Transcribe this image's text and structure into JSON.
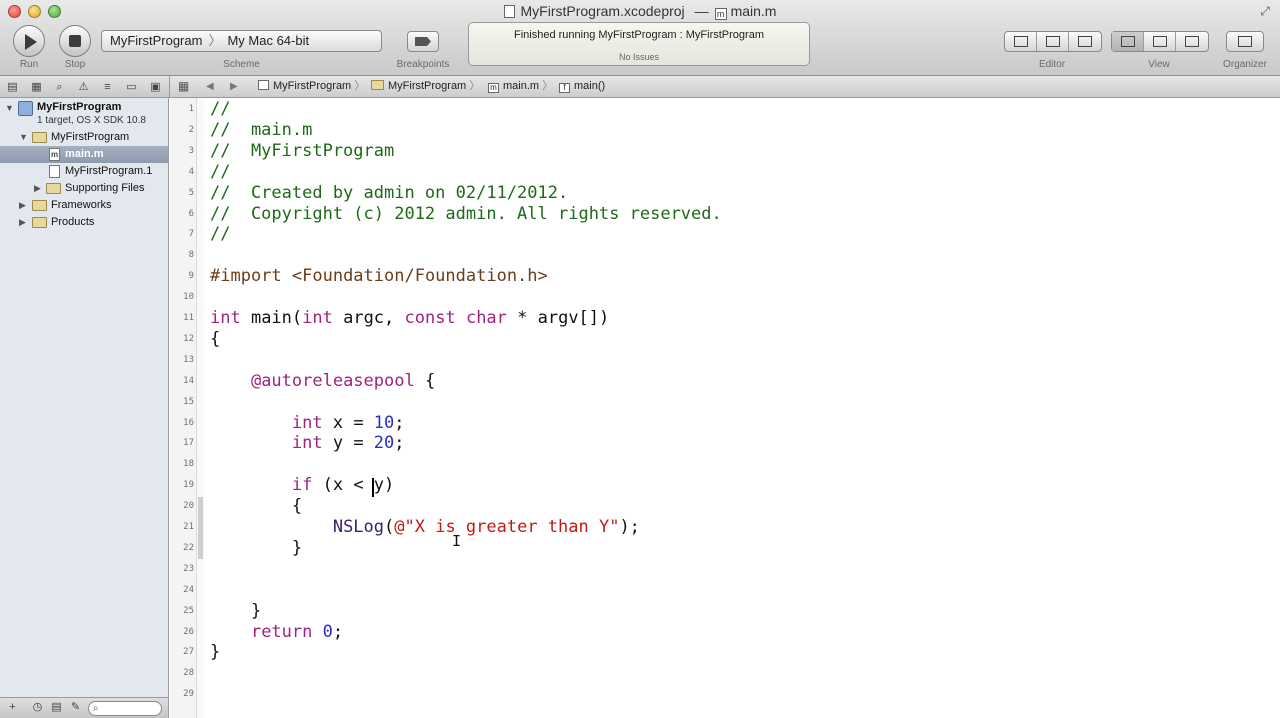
{
  "window": {
    "title_project_file": "MyFirstProgram.xcodeproj",
    "title_separator": "—",
    "title_file": "main.m"
  },
  "toolbar": {
    "run_label": "Run",
    "stop_label": "Stop",
    "scheme_target": "MyFirstProgram",
    "scheme_destination": "My Mac 64-bit",
    "scheme_label": "Scheme",
    "breakpoints_label": "Breakpoints",
    "activity_status": "Finished running MyFirstProgram : MyFirstProgram",
    "activity_issues": "No Issues",
    "editor_label": "Editor",
    "view_label": "View",
    "organizer_label": "Organizer"
  },
  "jump_bar": {
    "items": [
      "MyFirstProgram",
      "MyFirstProgram",
      "main.m",
      "main()"
    ],
    "file_icon_letter": "m",
    "func_icon_letter": "f"
  },
  "navigator": {
    "project_name": "MyFirstProgram",
    "project_subtitle": "1 target, OS X SDK 10.8",
    "items": [
      {
        "label": "MyFirstProgram",
        "type": "folder",
        "expanded": true
      },
      {
        "label": "main.m",
        "type": "file",
        "icon": "m",
        "selected": true
      },
      {
        "label": "MyFirstProgram.1",
        "type": "file",
        "icon": ""
      },
      {
        "label": "Supporting Files",
        "type": "folder",
        "expanded": false
      },
      {
        "label": "Frameworks",
        "type": "folder",
        "expanded": false
      },
      {
        "label": "Products",
        "type": "folder",
        "expanded": false
      }
    ]
  },
  "editor": {
    "language": "Objective-C",
    "caret_line": 19,
    "line_numbers": [
      "1",
      "2",
      "3",
      "4",
      "5",
      "6",
      "7",
      "8",
      "9",
      "10",
      "11",
      "12",
      "13",
      "14",
      "15",
      "16",
      "17",
      "18",
      "19",
      "20",
      "21",
      "22",
      "23",
      "24",
      "25",
      "26",
      "27",
      "28",
      "29"
    ],
    "lines": [
      [
        {
          "t": "//",
          "c": "comment"
        }
      ],
      [
        {
          "t": "//  main.m",
          "c": "comment"
        }
      ],
      [
        {
          "t": "//  MyFirstProgram",
          "c": "comment"
        }
      ],
      [
        {
          "t": "//",
          "c": "comment"
        }
      ],
      [
        {
          "t": "//  Created by admin on 02/11/2012.",
          "c": "comment"
        }
      ],
      [
        {
          "t": "//  Copyright (c) 2012 admin. All rights reserved.",
          "c": "comment"
        }
      ],
      [
        {
          "t": "//",
          "c": "comment"
        }
      ],
      [],
      [
        {
          "t": "#import ",
          "c": "pre"
        },
        {
          "t": "<Foundation/Foundation.h>",
          "c": "pre"
        }
      ],
      [],
      [
        {
          "t": "int",
          "c": "kw"
        },
        {
          "t": " main(",
          "c": ""
        },
        {
          "t": "int",
          "c": "kw"
        },
        {
          "t": " argc, ",
          "c": ""
        },
        {
          "t": "const",
          "c": "kw"
        },
        {
          "t": " ",
          "c": ""
        },
        {
          "t": "char",
          "c": "kw"
        },
        {
          "t": " * argv[])",
          "c": ""
        }
      ],
      [
        {
          "t": "{",
          "c": ""
        }
      ],
      [],
      [
        {
          "t": "    ",
          "c": ""
        },
        {
          "t": "@autoreleasepool",
          "c": "kw"
        },
        {
          "t": " {",
          "c": ""
        }
      ],
      [],
      [
        {
          "t": "        ",
          "c": ""
        },
        {
          "t": "int",
          "c": "kw"
        },
        {
          "t": " x = ",
          "c": ""
        },
        {
          "t": "10",
          "c": "num"
        },
        {
          "t": ";",
          "c": ""
        }
      ],
      [
        {
          "t": "        ",
          "c": ""
        },
        {
          "t": "int",
          "c": "kw"
        },
        {
          "t": " y = ",
          "c": ""
        },
        {
          "t": "20",
          "c": "num"
        },
        {
          "t": ";",
          "c": ""
        }
      ],
      [],
      [
        {
          "t": "        ",
          "c": ""
        },
        {
          "t": "if",
          "c": "kw"
        },
        {
          "t": " (x < y)",
          "c": ""
        }
      ],
      [
        {
          "t": "        {",
          "c": ""
        }
      ],
      [
        {
          "t": "            ",
          "c": ""
        },
        {
          "t": "NSLog",
          "c": "fn"
        },
        {
          "t": "(",
          "c": ""
        },
        {
          "t": "@\"X is greater than Y\"",
          "c": "str"
        },
        {
          "t": ");",
          "c": ""
        }
      ],
      [
        {
          "t": "        }",
          "c": ""
        }
      ],
      [],
      [],
      [
        {
          "t": "    }",
          "c": ""
        }
      ],
      [
        {
          "t": "    ",
          "c": ""
        },
        {
          "t": "return",
          "c": "kw"
        },
        {
          "t": " ",
          "c": ""
        },
        {
          "t": "0",
          "c": "num"
        },
        {
          "t": ";",
          "c": ""
        }
      ],
      [
        {
          "t": "}",
          "c": ""
        }
      ],
      [],
      []
    ]
  },
  "colors": {
    "comment": "#1d6a18",
    "keyword": "#a1237f",
    "preprocessor": "#6b3d1c",
    "string": "#c41a16",
    "number": "#2b2ec4",
    "function": "#3a1d72",
    "selection": "#8d9aad"
  },
  "icons": {
    "fullscreen": "fullscreen-icon",
    "run": "play-icon",
    "stop": "stop-icon",
    "breakpoints": "breakpoint-icon",
    "filter": "search-icon"
  }
}
